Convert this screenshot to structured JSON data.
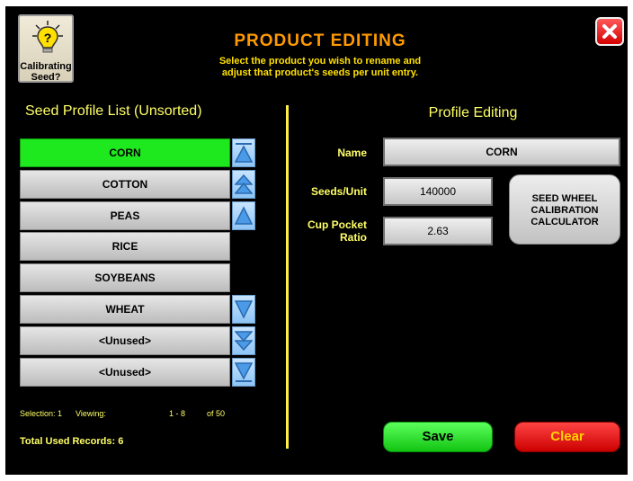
{
  "header": {
    "calibrating_button_label": "Calibrating Seed?",
    "title": "PRODUCT EDITING",
    "subtitle_line1": "Select the product you wish to rename and",
    "subtitle_line2": "adjust that product's seeds per unit entry."
  },
  "list": {
    "heading": "Seed Profile List (Unsorted)",
    "items": [
      {
        "label": "CORN",
        "selected": true
      },
      {
        "label": "COTTON",
        "selected": false
      },
      {
        "label": "PEAS",
        "selected": false
      },
      {
        "label": "RICE",
        "selected": false
      },
      {
        "label": "SOYBEANS",
        "selected": false
      },
      {
        "label": "WHEAT",
        "selected": false
      },
      {
        "label": "<Unused>",
        "selected": false
      },
      {
        "label": "<Unused>",
        "selected": false
      }
    ],
    "scroll_buttons_up": [
      "scroll-to-top-icon",
      "page-up-icon",
      "line-up-icon"
    ],
    "scroll_buttons_down": [
      "line-down-icon",
      "page-down-icon",
      "scroll-to-bottom-icon"
    ],
    "stats": {
      "selection": "Selection: 1",
      "viewing_label": "Viewing:",
      "viewing_range": "1 - 8",
      "viewing_total": "of 50"
    },
    "total_used_records": "Total Used Records: 6"
  },
  "editor": {
    "heading": "Profile Editing",
    "name_label": "Name",
    "name_value": "CORN",
    "seeds_unit_label": "Seeds/Unit",
    "seeds_unit_value": "140000",
    "cup_pocket_label_line1": "Cup Pocket",
    "cup_pocket_label_line2": "Ratio",
    "cup_pocket_value": "2.63",
    "calculator_line1": "SEED WHEEL",
    "calculator_line2": "CALIBRATION",
    "calculator_line3": "CALCULATOR",
    "save_label": "Save",
    "clear_label": "Clear"
  },
  "colors": {
    "background": "#000000",
    "accent_yellow": "#ffff66",
    "title_orange": "#ff9a00",
    "selected_green": "#1ee81e",
    "save_green": "#22dd22",
    "clear_red": "#dd0000"
  }
}
